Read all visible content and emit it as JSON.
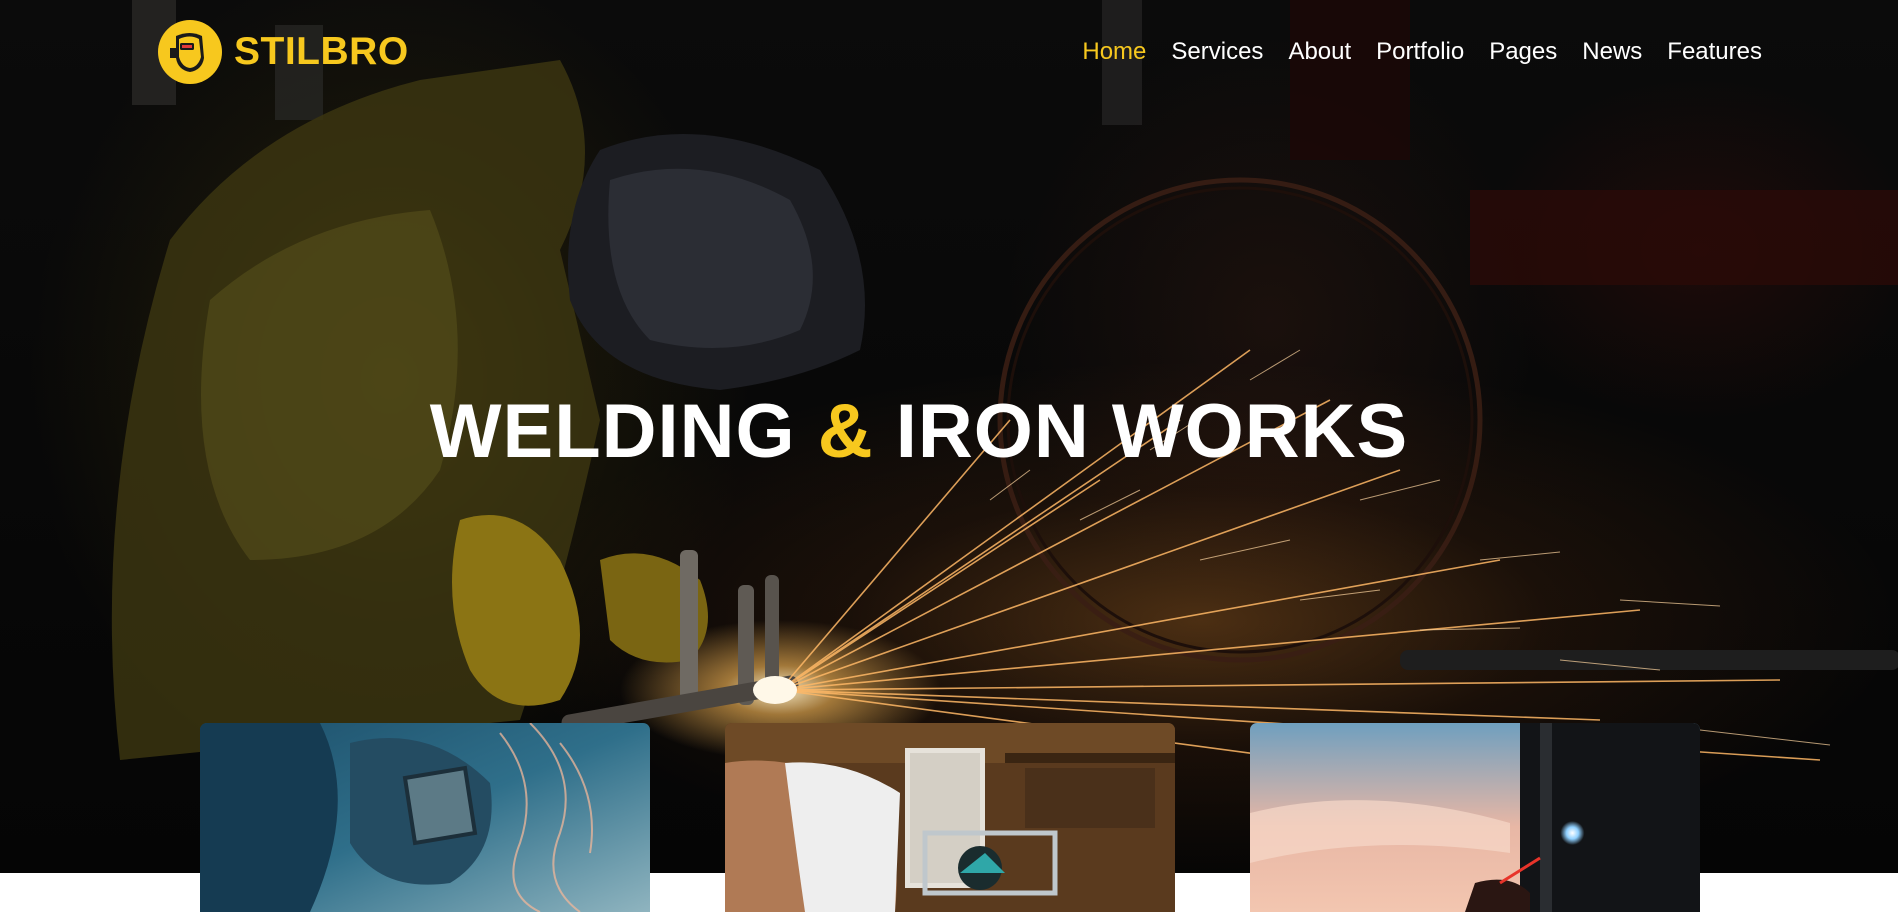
{
  "brand": {
    "name": "STILBRO",
    "logo_icon": "welding-mask-icon",
    "accent_color": "#f7c81e"
  },
  "nav": {
    "items": [
      {
        "label": "Home",
        "active": true
      },
      {
        "label": "Services",
        "active": false
      },
      {
        "label": "About",
        "active": false
      },
      {
        "label": "Portfolio",
        "active": false
      },
      {
        "label": "Pages",
        "active": false
      },
      {
        "label": "News",
        "active": false
      },
      {
        "label": "Features",
        "active": false
      }
    ]
  },
  "hero": {
    "headline_part1": "WELDING",
    "headline_amp": "&",
    "headline_part2": "IRON WORKS"
  },
  "cards": [
    {
      "image": "welder-with-mask-photo"
    },
    {
      "image": "metalworker-in-workshop-photo"
    },
    {
      "image": "welding-sparks-at-sunset-photo"
    }
  ]
}
